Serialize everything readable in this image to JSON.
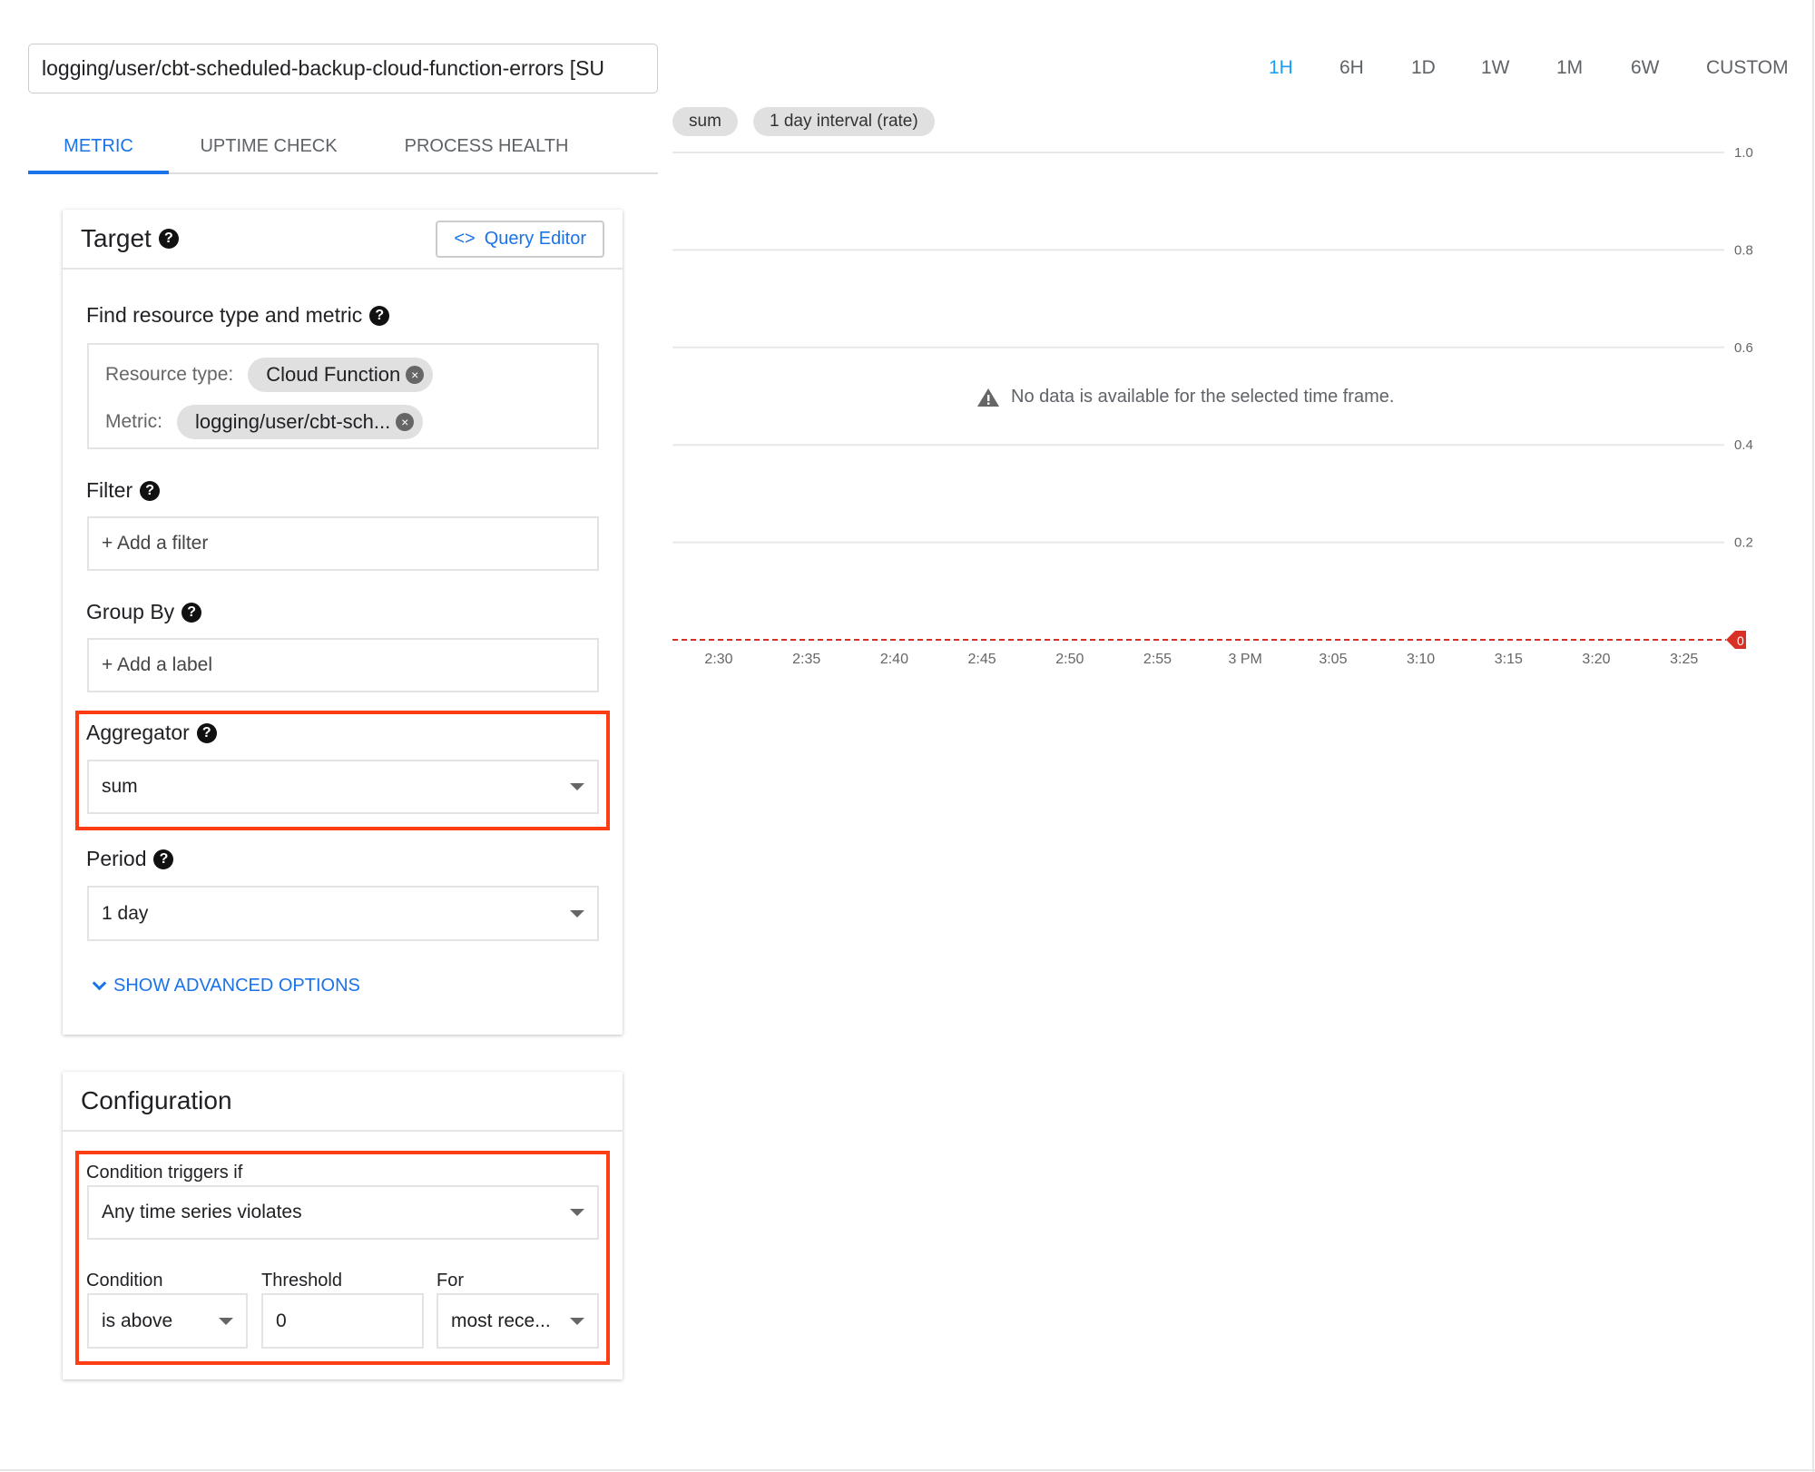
{
  "header": {
    "title_value": "logging/user/cbt-scheduled-backup-cloud-function-errors [SU"
  },
  "tabs": [
    {
      "label": "METRIC",
      "active": true
    },
    {
      "label": "UPTIME CHECK"
    },
    {
      "label": "PROCESS HEALTH"
    }
  ],
  "time_range": {
    "options": [
      "1H",
      "6H",
      "1D",
      "1W",
      "1M",
      "6W",
      "CUSTOM"
    ],
    "selected": "1H"
  },
  "chart_pills": [
    "sum",
    "1 day interval (rate)"
  ],
  "target": {
    "title": "Target",
    "query_editor_label": "Query Editor",
    "find_label": "Find resource type and metric",
    "resource_type_label": "Resource type:",
    "resource_type_value": "Cloud Function",
    "metric_label": "Metric:",
    "metric_value": "logging/user/cbt-sch...",
    "filter_label": "Filter",
    "filter_placeholder": "+ Add a filter",
    "group_by_label": "Group By",
    "group_by_placeholder": "+ Add a label",
    "aggregator_label": "Aggregator",
    "aggregator_value": "sum",
    "period_label": "Period",
    "period_value": "1 day",
    "advanced_label": "SHOW ADVANCED OPTIONS"
  },
  "configuration": {
    "title": "Configuration",
    "triggers_label": "Condition triggers if",
    "triggers_value": "Any time series violates",
    "condition_label": "Condition",
    "condition_value": "is above",
    "threshold_label": "Threshold",
    "threshold_value": "0",
    "for_label": "For",
    "for_value": "most rece..."
  },
  "colors": {
    "accent": "#1a73e8",
    "highlight": "#ff3d14",
    "threshold": "#d93025"
  },
  "chart_data": {
    "type": "line",
    "message": "No data is available for the selected time frame.",
    "series": [],
    "ylim": [
      0,
      1.0
    ],
    "yticks": [
      "0.2",
      "0.4",
      "0.6",
      "0.8",
      "1.0"
    ],
    "yvalues": [
      0.2,
      0.4,
      0.6,
      0.8,
      1.0
    ],
    "xticks": [
      "2:30",
      "2:35",
      "2:40",
      "2:45",
      "2:50",
      "2:55",
      "3 PM",
      "3:05",
      "3:10",
      "3:15",
      "3:20",
      "3:25"
    ],
    "threshold": {
      "value": 0,
      "label": "0"
    },
    "grid": true
  }
}
